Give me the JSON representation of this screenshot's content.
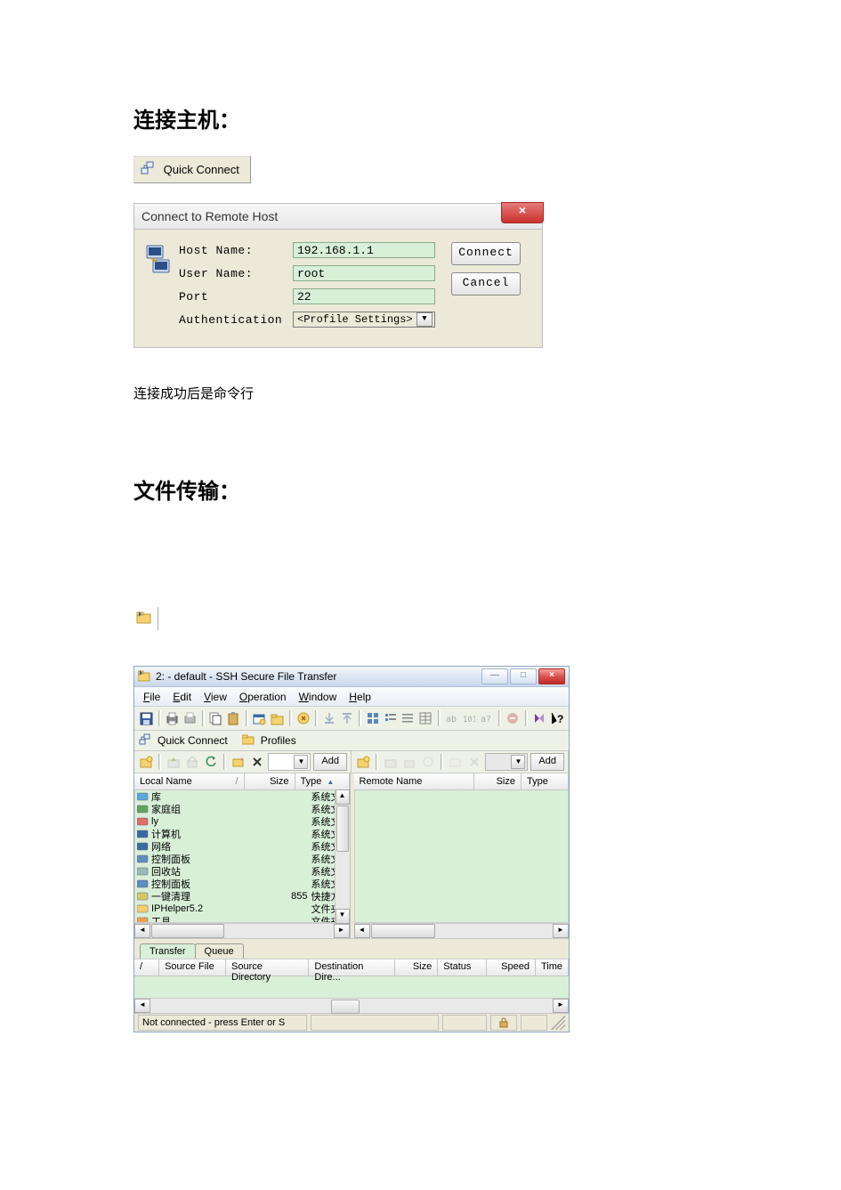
{
  "headings": {
    "connect": "连接主机：",
    "after_connect": "连接成功后是命令行",
    "file_transfer": "文件传输："
  },
  "quick_connect_button": "Quick Connect",
  "dialog": {
    "title": "Connect to Remote Host",
    "labels": {
      "host": "Host Name:",
      "user": "User Name:",
      "port": "Port",
      "auth": "Authentication"
    },
    "values": {
      "host": "192.168.1.1",
      "user": "root",
      "port": "22",
      "auth": "<Profile Settings>"
    },
    "buttons": {
      "connect": "Connect",
      "cancel": "Cancel"
    }
  },
  "ftwin": {
    "title": "2: - default - SSH Secure File Transfer",
    "menu": [
      "File",
      "Edit",
      "View",
      "Operation",
      "Window",
      "Help"
    ],
    "toolbar2": {
      "quick_connect": "Quick Connect",
      "profiles": "Profiles"
    },
    "pane_add": "Add",
    "local_header": {
      "name": "Local Name",
      "size": "Size",
      "type": "Type"
    },
    "remote_header": {
      "name": "Remote Name",
      "size": "Size",
      "type": "Type"
    },
    "local_files": [
      {
        "name": "库",
        "size": "",
        "type": "系统文",
        "color": "#5da9dd"
      },
      {
        "name": "家庭组",
        "size": "",
        "type": "系统文",
        "color": "#5fa65f"
      },
      {
        "name": "ly",
        "size": "",
        "type": "系统文",
        "color": "#e06b6b"
      },
      {
        "name": "计算机",
        "size": "",
        "type": "系统文",
        "color": "#3a6aa6"
      },
      {
        "name": "网络",
        "size": "",
        "type": "系统文",
        "color": "#3a6aa6"
      },
      {
        "name": "控制面板",
        "size": "",
        "type": "系统文",
        "color": "#5b8fc2"
      },
      {
        "name": "回收站",
        "size": "",
        "type": "系统文",
        "color": "#9bb8b8"
      },
      {
        "name": "控制面板",
        "size": "",
        "type": "系统文",
        "color": "#5b8fc2"
      },
      {
        "name": "一键清理",
        "size": "855",
        "type": "快捷方",
        "color": "#d6c76a"
      },
      {
        "name": "IPHelper5.2",
        "size": "",
        "type": "文件夹",
        "color": "#f3cf70"
      },
      {
        "name": "工具",
        "size": "",
        "type": "文件夹",
        "color": "#f0a050"
      }
    ],
    "tabs": [
      "Transfer",
      "Queue"
    ],
    "transfer_cols": [
      "/",
      "Source File",
      "Source Directory",
      "Destination Dire...",
      "Size",
      "Status",
      "Speed",
      "Time"
    ],
    "status": "Not connected - press Enter or S"
  }
}
